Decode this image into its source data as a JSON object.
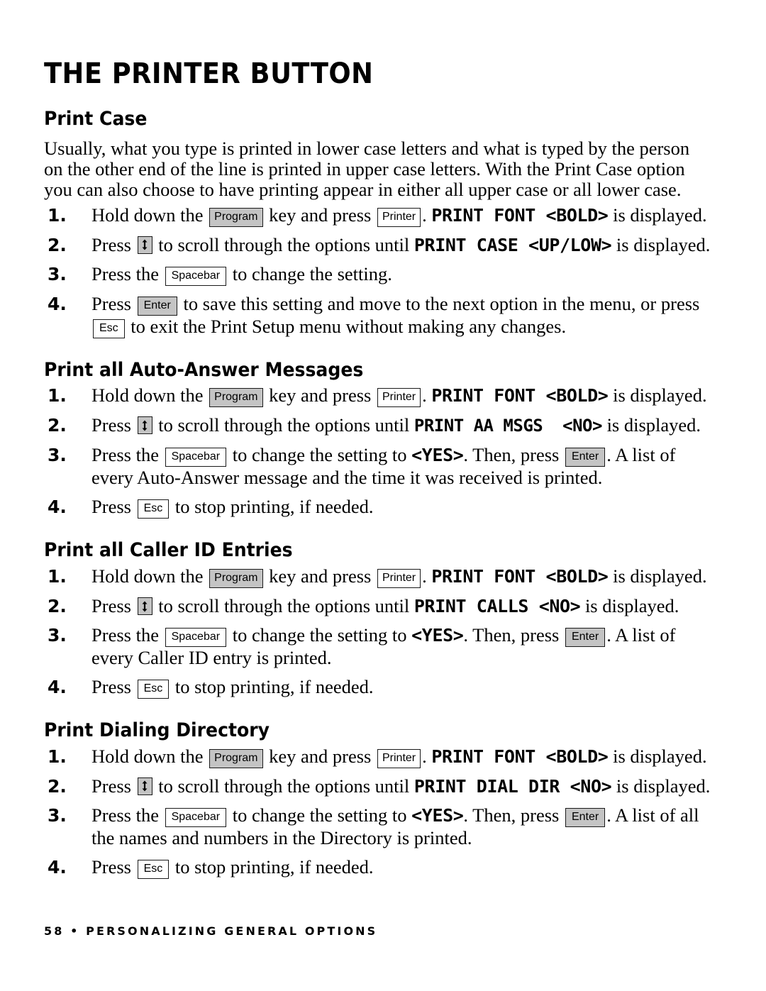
{
  "document": {
    "title": "THE PRINTER BUTTON",
    "footer": "58 • PERSONALIZING GENERAL OPTIONS",
    "page_number": "58",
    "footer_chapter": "PERSONALIZING GENERAL OPTIONS"
  },
  "keys": {
    "program": "Program",
    "printer": "Printer",
    "spacebar": "Spacebar",
    "enter": "Enter",
    "esc": "Esc",
    "scroll": "scroll-updown-key"
  },
  "colors": {
    "key_shaded_fill": "#c4c4c4",
    "key_plain_fill": "#ffffff",
    "key_border": "#1a1a1a",
    "text": "#000000",
    "page_background": "#ffffff"
  },
  "sections": [
    {
      "heading": "Print Case",
      "intro": "Usually, what you type is printed in lower case letters and what is typed by the person on the other end of the line is printed in upper case letters. With the Print Case option you can also choose to have printing appear in either all upper case or all lower case.",
      "steps": [
        {
          "number": "1.",
          "frag_a": "Hold down the",
          "frag_b": "key and press",
          "frag_c": ".",
          "lcd": "PRINT FONT <BOLD>",
          "frag_d": "is displayed."
        },
        {
          "number": "2.",
          "frag_a": "Press",
          "frag_b": "to scroll through the options until",
          "lcd": "PRINT CASE <UP/LOW>",
          "frag_c": "is displayed."
        },
        {
          "number": "3.",
          "frag_a": "Press the",
          "frag_b": "to change the setting."
        },
        {
          "number": "4.",
          "frag_a": "Press",
          "frag_b": "to save this setting and move to the next option in the menu, or press",
          "frag_c": "to exit the Print Setup menu without making any changes."
        }
      ]
    },
    {
      "heading": "Print all Auto-Answer Messages",
      "steps": [
        {
          "number": "1.",
          "frag_a": "Hold down the",
          "frag_b": "key and press",
          "frag_c": ".",
          "lcd": "PRINT FONT <BOLD>",
          "frag_d": "is displayed."
        },
        {
          "number": "2.",
          "frag_a": "Press",
          "frag_b": "to scroll through the options until",
          "lcd": "PRINT AA MSGS  <NO>",
          "frag_c": "is displayed."
        },
        {
          "number": "3.",
          "frag_a": "Press the",
          "frag_b": "to change the setting to",
          "lcd": "<YES>",
          "frag_c": ". Then, press",
          "frag_d": ". A list of every Auto-Answer message and the time it was received is printed."
        },
        {
          "number": "4.",
          "frag_a": "Press",
          "frag_b": "to stop printing, if needed."
        }
      ]
    },
    {
      "heading": "Print all Caller ID Entries",
      "steps": [
        {
          "number": "1.",
          "frag_a": "Hold down the",
          "frag_b": "key and press",
          "frag_c": ".",
          "lcd": "PRINT FONT <BOLD>",
          "frag_d": "is displayed."
        },
        {
          "number": "2.",
          "frag_a": "Press",
          "frag_b": "to scroll through the options until",
          "lcd": "PRINT CALLS <NO>",
          "frag_c": "is displayed."
        },
        {
          "number": "3.",
          "frag_a": "Press the",
          "frag_b": "to change the setting to",
          "lcd": "<YES>",
          "frag_c": ". Then, press",
          "frag_d": ". A list of every Caller ID entry is printed."
        },
        {
          "number": "4.",
          "frag_a": "Press",
          "frag_b": "to stop printing, if needed."
        }
      ]
    },
    {
      "heading": "Print Dialing Directory",
      "steps": [
        {
          "number": "1.",
          "frag_a": "Hold down the",
          "frag_b": "key and press",
          "frag_c": ".",
          "lcd": "PRINT FONT <BOLD>",
          "frag_d": "is displayed."
        },
        {
          "number": "2.",
          "frag_a": "Press",
          "frag_b": "to scroll through the options until",
          "lcd": "PRINT DIAL DIR <NO>",
          "frag_c": "is displayed."
        },
        {
          "number": "3.",
          "frag_a": "Press the",
          "frag_b": "to change the setting to",
          "lcd": "<YES>",
          "frag_c": ". Then, press",
          "frag_d": ". A list of all the names and numbers in the Directory is printed."
        },
        {
          "number": "4.",
          "frag_a": "Press",
          "frag_b": "to stop printing, if needed."
        }
      ]
    }
  ]
}
